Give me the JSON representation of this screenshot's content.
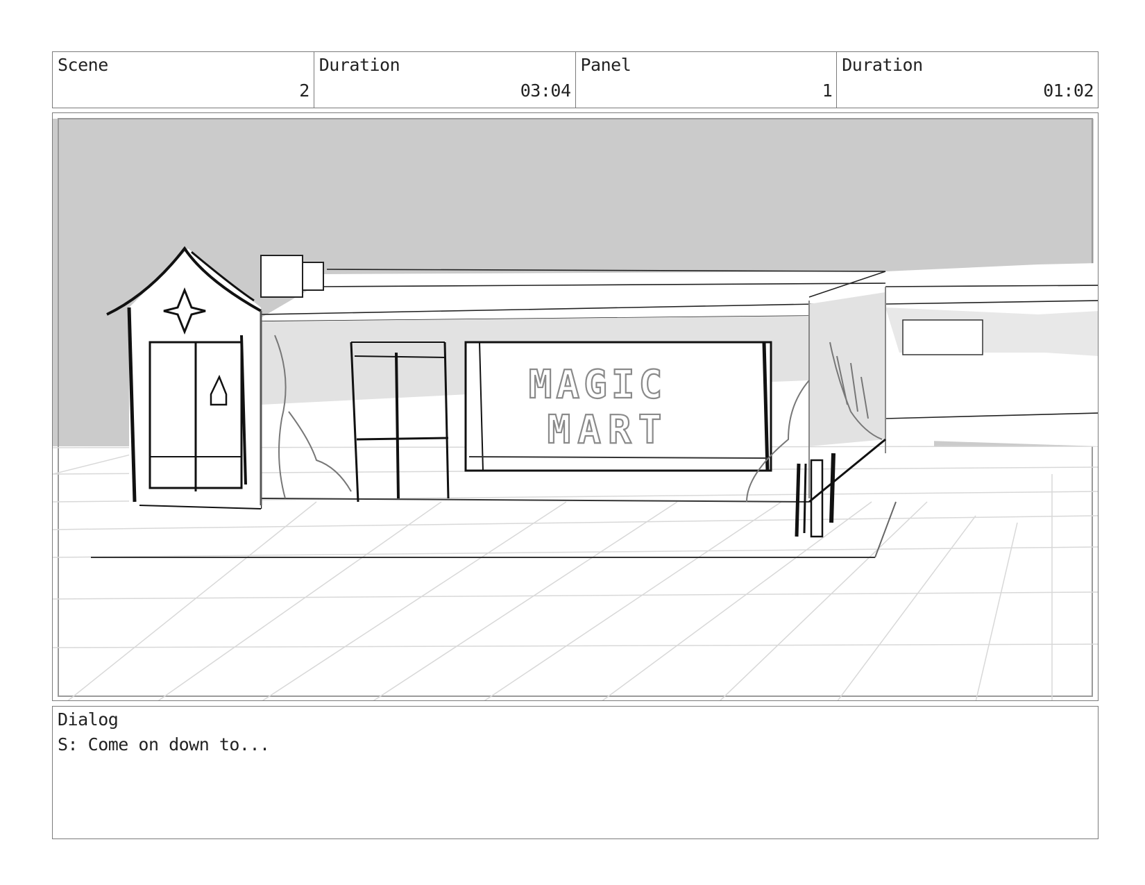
{
  "header": {
    "scene": {
      "label": "Scene",
      "value": "2"
    },
    "scene_duration": {
      "label": "Duration",
      "value": "03:04"
    },
    "panel": {
      "label": "Panel",
      "value": "1"
    },
    "panel_duration": {
      "label": "Duration",
      "value": "01:02"
    }
  },
  "sketch": {
    "sign_line1": "MAGIC",
    "sign_line2": "MART"
  },
  "dialog": {
    "label": "Dialog",
    "text": "S: Come on down to..."
  },
  "colors": {
    "frame_border": "#7a7a7a",
    "sky": "#cbcbcb",
    "wall_shade": "#e2e2e2",
    "ink": "#111111"
  }
}
